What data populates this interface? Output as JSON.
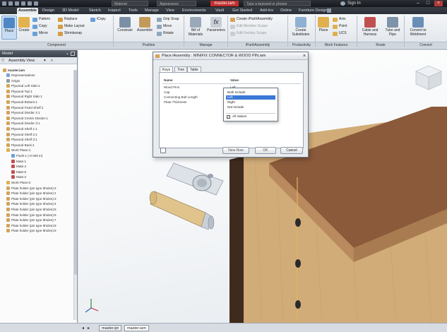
{
  "titlebar": {
    "project_dropdown": "Material",
    "appearance_dropdown": "Appearance",
    "document_title": "master.iam",
    "search_placeholder": "Type a keyword or phrase",
    "signin": "Sign In"
  },
  "ribbon_tabs": [
    "Assemble",
    "Design",
    "3D Model",
    "Sketch",
    "Inspect",
    "Tools",
    "Manage",
    "View",
    "Environments",
    "Vault",
    "Get Started",
    "Add-Ins",
    "Online",
    "Furniture Design"
  ],
  "ribbon": {
    "component": {
      "place": "Place",
      "create": "Create",
      "pattern": "Pattern",
      "copy": "Copy",
      "mirror": "Mirror",
      "replace": "Replace",
      "make_layout": "Make Layout",
      "shrinkwrap": "Shrinkwrap",
      "icopy": "iCopy",
      "group_label": "Component"
    },
    "position": {
      "constrain": "Constrain",
      "assemble": "Assemble",
      "grip_snap": "Grip Snap",
      "move": "Move",
      "rotate": "Rotate",
      "group_label": "Position"
    },
    "manage": {
      "bom": "Bill of Materials",
      "parameters": "Parameters",
      "group_label": "Manage"
    },
    "ipart": {
      "create": "Create iPart/iAssembly",
      "edit_member": "Edit Member Scope",
      "edit_factory": "Edit Factory Scope",
      "group_label": "iPart/iAssembly"
    },
    "productivity": {
      "create_substitutes": "Create Substitutes",
      "group_label": "Productivity"
    },
    "work_features": {
      "plane": "Plane",
      "axis": "Axis",
      "point": "Point",
      "ucs": "UCS",
      "group_label": "Work Features"
    },
    "route": {
      "cable": "Cable and Harness",
      "tube": "Tube and Pipe",
      "group_label": "Route"
    },
    "convert": {
      "weldment": "Convert to Weldment",
      "group_label": "Convert"
    }
  },
  "browser": {
    "title": "Model",
    "view_selector": "Assembly View",
    "root": "master.iam",
    "items": [
      "Representations",
      "Origin",
      "Plywood Left Side:1",
      "Plywood Top:1",
      "Plywood Right Side:1",
      "Plywood Bottom:1",
      "Plywood Fixed Shelf:1",
      "Plywood Divider 2:1",
      "Plywood Centre Divider:1",
      "Plywood Divider 3:1",
      "Plywood Shelf 1:1",
      "Plywood Shelf 2:1",
      "Plywood Shelf 3:1",
      "Plywood Back:1",
      "Work Plane:1",
      "Flush:1 (-0.000 in)",
      "Mate:1",
      "Mate:4",
      "Mate:5",
      "Mate:2",
      "Work Plane:2",
      "Plate holder (pin type 5holes):2",
      "Plate holder (pin type 5holes):1",
      "Plate holder (pin type 5holes):3",
      "Plate holder (pin type 5holes):4",
      "Plate holder (pin type 5holes):5",
      "Plate holder (pin type 5holes):6",
      "Plate holder (pin type 5holes):7",
      "Plate holder (pin type 5holes):8",
      "Plate holder (pin type 5holes):9"
    ]
  },
  "dialog": {
    "title": "Place iAssembly : MINIFIX CONNECTOR & WOOD PIN.iam",
    "tabs": [
      "Keys",
      "Tree",
      "Table"
    ],
    "header_name": "Name",
    "header_value": "Value",
    "rows": [
      {
        "name": "Wood Pins",
        "value": "Left"
      },
      {
        "name": "Cap",
        "value": ""
      },
      {
        "name": "Connecting Bolt Length",
        "value": ""
      },
      {
        "name": "Plate Thickness",
        "value": ""
      }
    ],
    "dropdown_options": [
      "Both Include",
      "Left",
      "Right",
      "Not Include"
    ],
    "dropdown_selected": "Left",
    "all_values_label": "All Values",
    "buttons": {
      "new_row": "New Row",
      "ok": "OK",
      "cancel": "Cancel"
    }
  },
  "doc_tabs": [
    "master.ipt",
    "master.iam"
  ],
  "colors": {
    "accent": "#3a78d6",
    "title_red": "#c43030",
    "wood_top": "#8b5a3a",
    "wood_edge": "#b9885d",
    "wood_side": "#c9a371"
  }
}
